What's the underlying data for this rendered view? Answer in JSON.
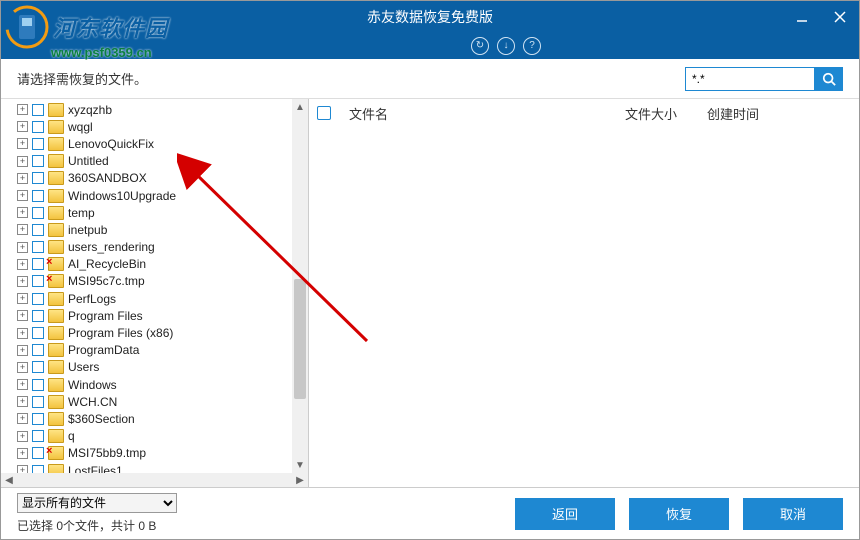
{
  "watermark": {
    "brand": "河东软件园",
    "url": "www.psf0359.cn"
  },
  "window": {
    "title": "赤友数据恢复免费版"
  },
  "toolbar": {
    "icons": [
      "refresh-circle",
      "down-circle",
      "help-circle"
    ]
  },
  "header": {
    "prompt": "请选择需恢复的文件。",
    "search_value": "*.*"
  },
  "tree": {
    "items": [
      {
        "label": "xyzqzhb",
        "del": false
      },
      {
        "label": "wqgl",
        "del": false
      },
      {
        "label": "LenovoQuickFix",
        "del": false
      },
      {
        "label": "Untitled",
        "del": false
      },
      {
        "label": "360SANDBOX",
        "del": false
      },
      {
        "label": "Windows10Upgrade",
        "del": false
      },
      {
        "label": "temp",
        "del": false
      },
      {
        "label": "inetpub",
        "del": false
      },
      {
        "label": "users_rendering",
        "del": false
      },
      {
        "label": "AI_RecycleBin",
        "del": true
      },
      {
        "label": "MSI95c7c.tmp",
        "del": true
      },
      {
        "label": "PerfLogs",
        "del": false
      },
      {
        "label": "Program Files",
        "del": false
      },
      {
        "label": "Program Files (x86)",
        "del": false
      },
      {
        "label": "ProgramData",
        "del": false
      },
      {
        "label": "Users",
        "del": false
      },
      {
        "label": "Windows",
        "del": false
      },
      {
        "label": "WCH.CN",
        "del": false
      },
      {
        "label": "$360Section",
        "del": false
      },
      {
        "label": "q",
        "del": false
      },
      {
        "label": "MSI75bb9.tmp",
        "del": true
      },
      {
        "label": "LostFiles1",
        "del": false
      }
    ]
  },
  "list": {
    "columns": {
      "name": "文件名",
      "size": "文件大小",
      "time": "创建时间"
    }
  },
  "footer": {
    "filter": "显示所有的文件",
    "status": "已选择 0个文件，共计 0 B",
    "buttons": {
      "back": "返回",
      "recover": "恢复",
      "cancel": "取消"
    }
  }
}
